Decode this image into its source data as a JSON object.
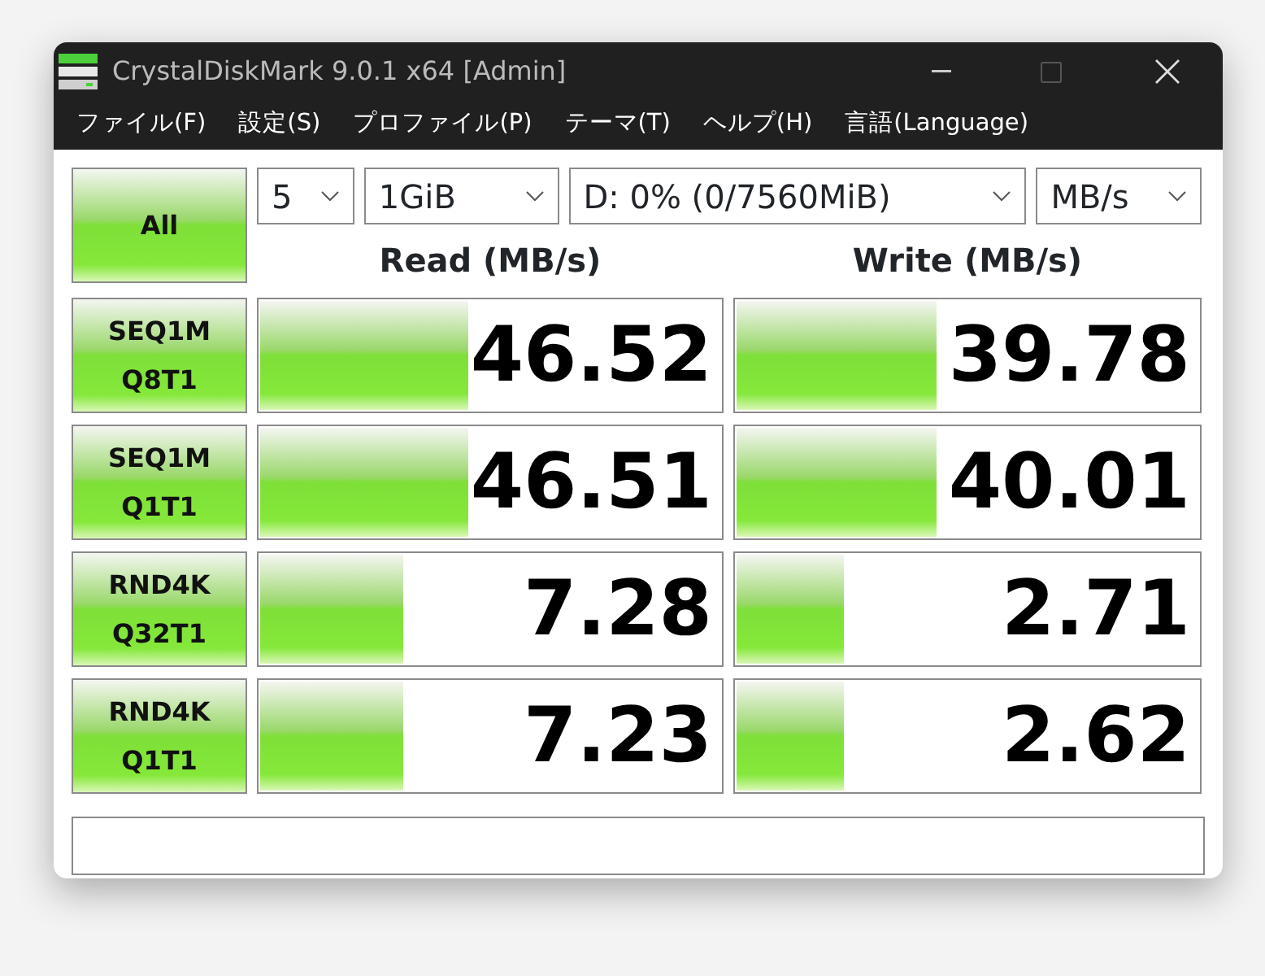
{
  "window": {
    "title": "CrystalDiskMark 9.0.1 x64 [Admin]"
  },
  "menu": [
    "ファイル(F)",
    "設定(S)",
    "プロファイル(P)",
    "テーマ(T)",
    "ヘルプ(H)",
    "言語(Language)"
  ],
  "all_button": "All",
  "selects": [
    {
      "value": "5"
    },
    {
      "value": "1GiB"
    },
    {
      "value": "D: 0% (0/7560MiB)"
    },
    {
      "value": "MB/s"
    }
  ],
  "headers": [
    "Read (MB/s)",
    "Write (MB/s)"
  ],
  "tests": [
    {
      "name": [
        "SEQ1M",
        "Q8T1"
      ],
      "read": {
        "value": "46.52",
        "level": 0.45
      },
      "write": {
        "value": "39.78",
        "level": 0.43
      }
    },
    {
      "name": [
        "SEQ1M",
        "Q1T1"
      ],
      "read": {
        "value": "46.51",
        "level": 0.45
      },
      "write": {
        "value": "40.01",
        "level": 0.43
      }
    },
    {
      "name": [
        "RND4K",
        "Q32T1"
      ],
      "read": {
        "value": "7.28",
        "level": 0.31
      },
      "write": {
        "value": "2.71",
        "level": 0.23
      }
    },
    {
      "name": [
        "RND4K",
        "Q1T1"
      ],
      "read": {
        "value": "7.23",
        "level": 0.31
      },
      "write": {
        "value": "2.62",
        "level": 0.23
      }
    }
  ]
}
